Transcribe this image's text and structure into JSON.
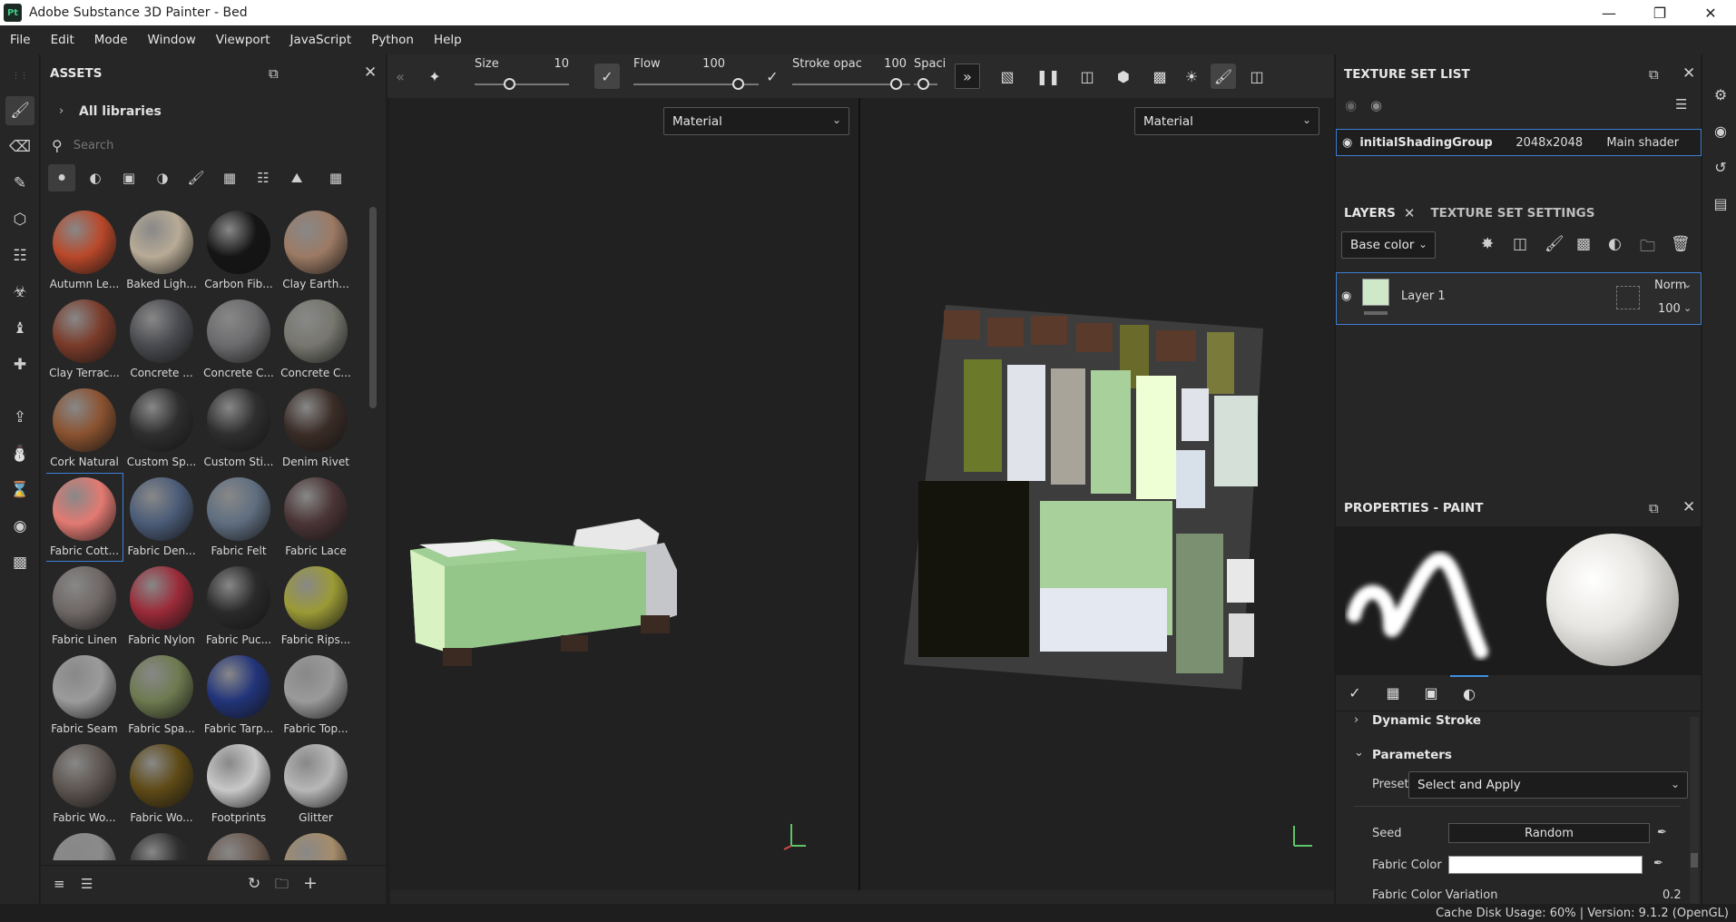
{
  "window": {
    "app_icon": "Pt",
    "title": "Adobe Substance 3D Painter - Bed"
  },
  "menu": [
    "File",
    "Edit",
    "Mode",
    "Window",
    "Viewport",
    "JavaScript",
    "Python",
    "Help"
  ],
  "assets": {
    "title": "ASSETS",
    "library": "All libraries",
    "search_placeholder": "Search",
    "items": [
      {
        "label": "Autumn Le...",
        "color": "#b9482a"
      },
      {
        "label": "Baked Ligh...",
        "color": "#b8ab96"
      },
      {
        "label": "Carbon Fib...",
        "color": "#151515"
      },
      {
        "label": "Clay Earth...",
        "color": "#9c7a64"
      },
      {
        "label": "Clay Terrac...",
        "color": "#7a3b2a"
      },
      {
        "label": "Concrete ...",
        "color": "#4a4b50"
      },
      {
        "label": "Concrete C...",
        "color": "#6b6b6d"
      },
      {
        "label": "Concrete C...",
        "color": "#77776f"
      },
      {
        "label": "Cork Natural",
        "color": "#8a5230"
      },
      {
        "label": "Custom Sp...",
        "color": "#2e2e2e"
      },
      {
        "label": "Custom Sti...",
        "color": "#2e2e2e"
      },
      {
        "label": "Denim Rivet",
        "color": "#3a2c26"
      },
      {
        "label": "Fabric Cott...",
        "color": "#e27a72"
      },
      {
        "label": "Fabric Den...",
        "color": "#4b5c78"
      },
      {
        "label": "Fabric Felt",
        "color": "#5f6e80"
      },
      {
        "label": "Fabric Lace",
        "color": "#4a3436"
      },
      {
        "label": "Fabric Linen",
        "color": "#6e6765"
      },
      {
        "label": "Fabric Nylon",
        "color": "#9a2a38"
      },
      {
        "label": "Fabric Puc...",
        "color": "#2a2a2a"
      },
      {
        "label": "Fabric Rips...",
        "color": "#9b9a36"
      },
      {
        "label": "Fabric Seam",
        "color": "#9b9b9b"
      },
      {
        "label": "Fabric Spa...",
        "color": "#6e7a50"
      },
      {
        "label": "Fabric Tarp...",
        "color": "#22347a"
      },
      {
        "label": "Fabric Top...",
        "color": "#9a9a9a"
      },
      {
        "label": "Fabric Wo...",
        "color": "#5d5550"
      },
      {
        "label": "Fabric Wo...",
        "color": "#5e4a16"
      },
      {
        "label": "Footprints",
        "color": "#c8c8c8"
      },
      {
        "label": "Glitter",
        "color": "#b7b7b7"
      },
      {
        "label": "",
        "color": "#8a8a8a"
      },
      {
        "label": "",
        "color": "#2e2e2e"
      },
      {
        "label": "",
        "color": "#6a5a50"
      },
      {
        "label": "",
        "color": "#a58c6a"
      }
    ]
  },
  "toolbar": {
    "size_label": "Size",
    "size_value": "10",
    "flow_label": "Flow",
    "flow_value": "100",
    "stroke_label": "Stroke opac",
    "stroke_value": "100",
    "spacing_label": "Spaci"
  },
  "viewport": {
    "left_mode": "Material",
    "right_mode": "Material"
  },
  "texture_set_list": {
    "title": "TEXTURE SET LIST",
    "row": {
      "name": "initialShadingGroup",
      "resolution": "2048x2048",
      "shader": "Main shader"
    }
  },
  "layers": {
    "tabs": [
      "LAYERS",
      "TEXTURE SET SETTINGS"
    ],
    "channel": "Base color",
    "layer": {
      "name": "Layer 1",
      "blend": "Norm",
      "opacity": "100"
    }
  },
  "properties": {
    "title": "PROPERTIES - PAINT",
    "dynamic_stroke": "Dynamic Stroke",
    "parameters": "Parameters",
    "preset_label": "Preset",
    "preset_value": "Select and Apply",
    "seed_label": "Seed",
    "seed_value": "Random",
    "fabric_color_label": "Fabric Color",
    "fabric_variation_label": "Fabric Color Variation",
    "fabric_variation_value": "0.2"
  },
  "status": "Cache Disk Usage:  60%  |  Version: 9.1.2 (OpenGL)"
}
